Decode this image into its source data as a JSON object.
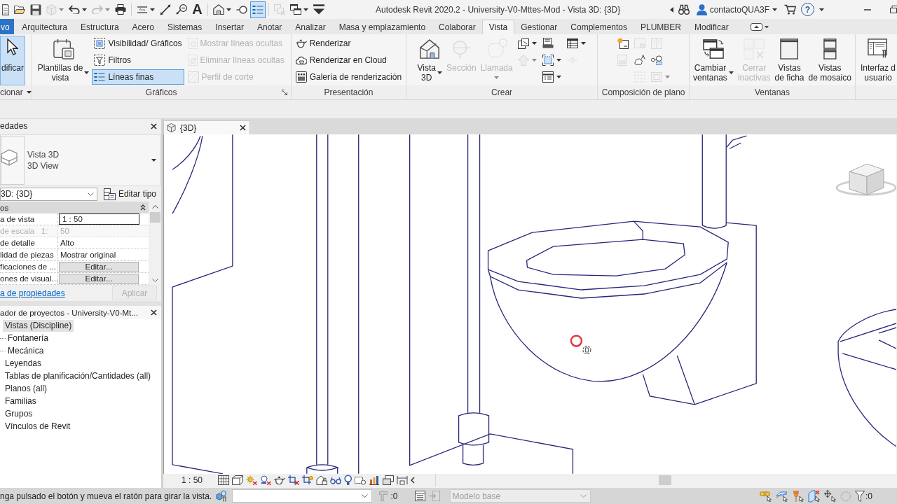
{
  "title_bar": {
    "quick_access": [
      [
        {
          "dropdown": false,
          "disabled": false,
          "on": false
        },
        {
          "dropdown": false,
          "disabled": false,
          "on": false
        },
        {
          "dropdown": false,
          "disabled": false,
          "on": false
        },
        {
          "dropdown": true,
          "disabled": true,
          "on": false
        },
        {
          "dropdown": true,
          "disabled": false,
          "on": false
        },
        {
          "dropdown": true,
          "disabled": true,
          "on": false
        },
        {
          "dropdown": false,
          "disabled": false,
          "on": false
        }
      ],
      [
        {
          "dropdown": true,
          "disabled": false,
          "on": false
        },
        {
          "dropdown": false,
          "disabled": false,
          "on": false
        },
        {
          "dropdown": false,
          "disabled": false,
          "on": false
        },
        {
          "label": "A",
          "dropdown": false,
          "disabled": false,
          "on": false
        }
      ],
      [
        {
          "dropdown": true,
          "disabled": false,
          "on": false
        },
        {
          "dropdown": false,
          "disabled": false,
          "on": false
        },
        {
          "dropdown": false,
          "disabled": false,
          "on": true
        }
      ],
      [
        {
          "dropdown": false,
          "disabled": true,
          "on": false
        },
        {
          "dropdown": true,
          "disabled": false,
          "on": false
        },
        {
          "dropdown": false,
          "disabled": false,
          "on": false
        }
      ]
    ],
    "title": "Autodesk Revit 2020.2 - University-V0-Mttes-Mod - Vista 3D: {3D}",
    "user": "contactoQUA3F",
    "help": "?"
  },
  "ribbon_tabs": [
    {
      "label": "vo",
      "kind": "file",
      "selected": false
    },
    {
      "label": "Arquitectura",
      "kind": "tab",
      "selected": false
    },
    {
      "label": "Estructura",
      "kind": "tab",
      "selected": false
    },
    {
      "label": "Acero",
      "kind": "tab",
      "selected": false
    },
    {
      "label": "Sistemas",
      "kind": "tab",
      "selected": false
    },
    {
      "label": "Insertar",
      "kind": "tab",
      "selected": false
    },
    {
      "label": "Anotar",
      "kind": "tab",
      "selected": false
    },
    {
      "label": "Analizar",
      "kind": "tab",
      "selected": false
    },
    {
      "label": "Masa y emplazamiento",
      "kind": "tab",
      "selected": false
    },
    {
      "label": "Colaborar",
      "kind": "tab",
      "selected": false
    },
    {
      "label": "Vista",
      "kind": "tab",
      "selected": true
    },
    {
      "label": "Gestionar",
      "kind": "tab",
      "selected": false
    },
    {
      "label": "Complementos",
      "kind": "tab",
      "selected": false
    },
    {
      "label": "PLUMBER",
      "kind": "tab",
      "selected": false
    },
    {
      "label": "Modificar",
      "kind": "tab",
      "selected": false
    }
  ],
  "ribbon": {
    "panels": [
      {
        "title": "cionar",
        "dropdown": true,
        "launcher": false,
        "items": [
          {
            "kind": "large",
            "label_lines": [
              "dificar"
            ],
            "dropdown": false,
            "disabled": false,
            "on": true
          }
        ]
      },
      {
        "title": "Gráficos",
        "dropdown": false,
        "launcher": true,
        "items": [
          {
            "kind": "large",
            "label_lines": [
              "Plantillas de",
              "vista"
            ],
            "dropdown": true,
            "disabled": false,
            "on": false
          },
          {
            "kind": "stack",
            "buttons": [
              {
                "label": "Visibilidad/ Gráficos",
                "dropdown": false,
                "disabled": false,
                "on": false
              },
              {
                "label": "Filtros",
                "dropdown": false,
                "disabled": false,
                "on": false
              },
              {
                "label": "Líneas finas",
                "dropdown": false,
                "disabled": false,
                "on": true
              }
            ]
          },
          {
            "kind": "stack",
            "buttons": [
              {
                "label": "Mostrar líneas ocultas",
                "dropdown": false,
                "disabled": true,
                "on": false
              },
              {
                "label": "Eliminar líneas ocultas",
                "dropdown": false,
                "disabled": true,
                "on": false
              },
              {
                "label": "Perfil de corte",
                "dropdown": false,
                "disabled": true,
                "on": false
              }
            ]
          }
        ]
      },
      {
        "title": "Presentación",
        "dropdown": false,
        "launcher": false,
        "items": [
          {
            "kind": "stack",
            "buttons": [
              {
                "label": "Renderizar",
                "dropdown": false,
                "disabled": false,
                "on": false
              },
              {
                "label": "Renderizar en Cloud",
                "dropdown": false,
                "disabled": false,
                "on": false
              },
              {
                "label": "Galería de renderización",
                "dropdown": false,
                "disabled": false,
                "on": false
              }
            ]
          }
        ]
      },
      {
        "title": "Crear",
        "dropdown": false,
        "launcher": false,
        "items": [
          {
            "kind": "large",
            "label_lines": [
              "Vista",
              "3D"
            ],
            "dropdown": true,
            "disabled": false,
            "on": false
          },
          {
            "kind": "large",
            "label_lines": [
              "Sección"
            ],
            "dropdown": false,
            "disabled": true,
            "on": false
          },
          {
            "kind": "large",
            "label_lines": [
              "Llamada"
            ],
            "dropdown": true,
            "disabled": true,
            "on": false
          },
          {
            "kind": "stack",
            "buttons": [
              {
                "dropdown": true,
                "disabled": false,
                "on": false
              },
              {
                "dropdown": true,
                "disabled": true,
                "on": false
              }
            ]
          },
          {
            "kind": "stack",
            "buttons": [
              {
                "dropdown": false,
                "disabled": false,
                "on": false
              },
              {
                "dropdown": true,
                "disabled": false,
                "on": false
              },
              {
                "dropdown": true,
                "disabled": false,
                "on": false
              }
            ]
          },
          {
            "kind": "stack",
            "buttons": [
              {
                "dropdown": true,
                "disabled": false,
                "on": false
              },
              {
                "dropdown": false,
                "disabled": true,
                "on": false
              }
            ]
          }
        ]
      },
      {
        "title": "Composición de plano",
        "dropdown": false,
        "launcher": false,
        "items": [
          {
            "kind": "stack",
            "buttons": [
              {
                "dropdown": false,
                "disabled": false,
                "on": false
              },
              {
                "dropdown": false,
                "disabled": true,
                "on": false
              }
            ]
          },
          {
            "kind": "stack",
            "buttons": [
              {
                "dropdown": false,
                "disabled": true,
                "on": false
              },
              {
                "dropdown": false,
                "disabled": false,
                "on": false
              },
              {
                "dropdown": false,
                "disabled": true,
                "on": false
              }
            ]
          },
          {
            "kind": "stack",
            "buttons": [
              {
                "dropdown": false,
                "disabled": true,
                "on": false
              },
              {
                "dropdown": false,
                "disabled": false,
                "on": false
              },
              {
                "dropdown": true,
                "disabled": true,
                "on": false
              }
            ]
          }
        ]
      },
      {
        "title": "Ventanas",
        "dropdown": false,
        "launcher": false,
        "items": [
          {
            "kind": "large",
            "label_lines": [
              "Cambiar",
              "ventanas"
            ],
            "dropdown": true,
            "disabled": false,
            "on": false
          },
          {
            "kind": "large",
            "label_lines": [
              "Cerrar",
              "inactivas"
            ],
            "dropdown": false,
            "disabled": true,
            "on": false
          },
          {
            "kind": "large",
            "label_lines": [
              "Vistas",
              "de ficha"
            ],
            "dropdown": false,
            "disabled": false,
            "on": false
          },
          {
            "kind": "large",
            "label_lines": [
              "Vistas",
              "de mosaico"
            ],
            "dropdown": false,
            "disabled": false,
            "on": false
          }
        ]
      },
      {
        "dropdown": false,
        "launcher": false,
        "items": [
          {
            "kind": "large",
            "label_lines": [
              "Interfaz d",
              "usuario"
            ],
            "dropdown": false,
            "disabled": false,
            "on": false
          }
        ]
      }
    ]
  },
  "properties": {
    "title": "edades",
    "type_selector": {
      "lines": [
        "Vista 3D",
        "3D View"
      ]
    },
    "instance": "3D: {3D}",
    "edit_type": "Editar tipo",
    "group": "os",
    "rows": [
      {
        "label": "a de vista",
        "value": "1 : 50",
        "kind": "input",
        "disabled": false
      },
      {
        "label": "de escala   1:",
        "value": "50",
        "kind": "text",
        "disabled": true
      },
      {
        "label": "de detalle",
        "value": "Alto",
        "kind": "text",
        "disabled": false
      },
      {
        "label": "lidad de piezas",
        "value": "Mostrar original",
        "kind": "text",
        "disabled": false
      },
      {
        "label": "ficaciones de ...",
        "value": "Editar...",
        "kind": "button",
        "disabled": false
      },
      {
        "label": "ones de visual...",
        "value": "Editar...",
        "kind": "button",
        "disabled": false
      }
    ],
    "help_link": "a de propiedades",
    "apply": {
      "label": "Aplicar",
      "disabled": true
    }
  },
  "project_browser": {
    "title": "ador de proyectos - University-V0-Mt...",
    "tree": [
      {
        "label": "Vistas (Discipline)",
        "selected": true,
        "children": [
          {
            "label": "Fontanería",
            "selected": false
          },
          {
            "label": "Mecánica",
            "selected": false
          }
        ]
      },
      {
        "label": "Leyendas",
        "selected": false
      },
      {
        "label": "Tablas de planificación/Cantidades (all)",
        "selected": false
      },
      {
        "label": "Planos (all)",
        "selected": false
      },
      {
        "label": "Familias",
        "selected": false
      },
      {
        "label": "Grupos",
        "selected": false
      },
      {
        "label": "Vínculos de Revit",
        "selected": false
      }
    ]
  },
  "view": {
    "tabs": [
      {
        "label": "{3D}",
        "selected": true
      }
    ],
    "scale": "1 : 50"
  },
  "status_bar": {
    "message": "nga pulsado el botón y mueva el ratón para girar la vista.",
    "editable_count": ":0",
    "design_option": {
      "value": "Modelo base",
      "disabled": true
    },
    "filter_count": ":0"
  }
}
